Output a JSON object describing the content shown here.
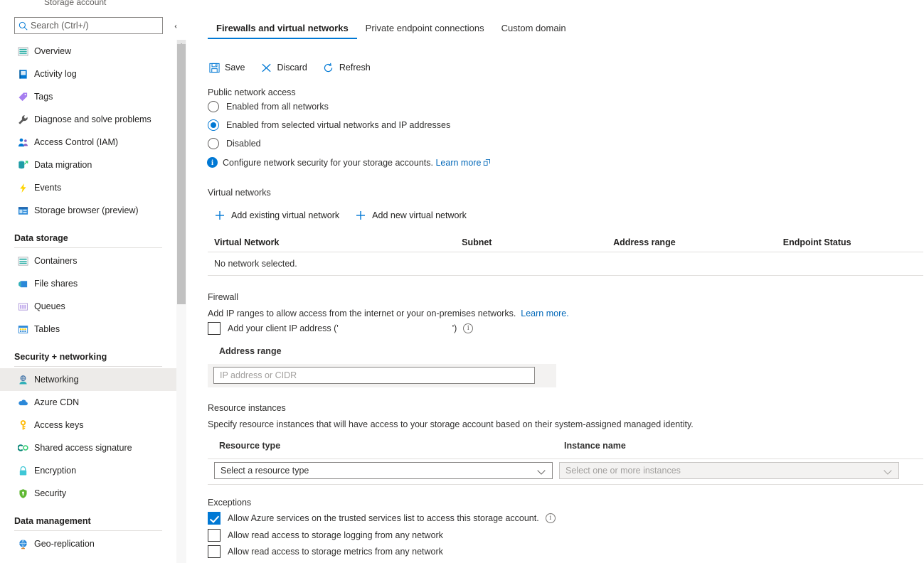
{
  "breadcrumb": {
    "resource_type": "Storage account"
  },
  "sidebar": {
    "search": {
      "placeholder": "Search (Ctrl+/)",
      "value": "",
      "icon": "search-icon"
    },
    "collapse_icon": "chevron-double-left-icon",
    "items": [
      {
        "label": "Overview",
        "icon": "overview-icon",
        "type": "item",
        "selected": false
      },
      {
        "label": "Activity log",
        "icon": "activity-log-icon",
        "type": "item",
        "selected": false
      },
      {
        "label": "Tags",
        "icon": "tags-icon",
        "type": "item",
        "selected": false
      },
      {
        "label": "Diagnose and solve problems",
        "icon": "wrench-icon",
        "type": "item",
        "selected": false
      },
      {
        "label": "Access Control (IAM)",
        "icon": "access-control-icon",
        "type": "item",
        "selected": false
      },
      {
        "label": "Data migration",
        "icon": "data-migration-icon",
        "type": "item",
        "selected": false
      },
      {
        "label": "Events",
        "icon": "events-lightning-icon",
        "type": "item",
        "selected": false
      },
      {
        "label": "Storage browser (preview)",
        "icon": "storage-browser-icon",
        "type": "item",
        "selected": false
      },
      {
        "label": "Data storage",
        "type": "group"
      },
      {
        "label": "Containers",
        "icon": "containers-icon",
        "type": "item",
        "selected": false
      },
      {
        "label": "File shares",
        "icon": "file-shares-icon",
        "type": "item",
        "selected": false
      },
      {
        "label": "Queues",
        "icon": "queues-icon",
        "type": "item",
        "selected": false
      },
      {
        "label": "Tables",
        "icon": "tables-icon",
        "type": "item",
        "selected": false
      },
      {
        "label": "Security + networking",
        "type": "group"
      },
      {
        "label": "Networking",
        "icon": "networking-icon",
        "type": "item",
        "selected": true
      },
      {
        "label": "Azure CDN",
        "icon": "cloud-icon",
        "type": "item",
        "selected": false
      },
      {
        "label": "Access keys",
        "icon": "key-icon",
        "type": "item",
        "selected": false
      },
      {
        "label": "Shared access signature",
        "icon": "shared-access-signature-icon",
        "type": "item",
        "selected": false
      },
      {
        "label": "Encryption",
        "icon": "lock-icon",
        "type": "item",
        "selected": false
      },
      {
        "label": "Security",
        "icon": "shield-icon",
        "type": "item",
        "selected": false
      },
      {
        "label": "Data management",
        "type": "group"
      },
      {
        "label": "Geo-replication",
        "icon": "globe-icon",
        "type": "item",
        "selected": false
      }
    ]
  },
  "main": {
    "tabs": [
      {
        "label": "Firewalls and virtual networks",
        "active": true
      },
      {
        "label": "Private endpoint connections",
        "active": false
      },
      {
        "label": "Custom domain",
        "active": false
      }
    ],
    "toolbar": [
      {
        "label": "Save",
        "icon": "save-disk-icon"
      },
      {
        "label": "Discard",
        "icon": "discard-x-icon"
      },
      {
        "label": "Refresh",
        "icon": "refresh-circular-arrow-icon"
      }
    ],
    "public_network_access": {
      "title": "Public network access",
      "options": [
        {
          "label": "Enabled from all networks",
          "checked": false
        },
        {
          "label": "Enabled from selected virtual networks and IP addresses",
          "checked": true
        },
        {
          "label": "Disabled",
          "checked": false
        }
      ],
      "info": {
        "icon": "info-circle-icon",
        "text": "Configure network security for your storage accounts.",
        "link": "Learn more",
        "link_icon": "external-link-icon"
      }
    },
    "virtual_networks": {
      "title": "Virtual networks",
      "actions": [
        {
          "label": "Add existing virtual network",
          "icon": "plus-icon"
        },
        {
          "label": "Add new virtual network",
          "icon": "plus-icon"
        }
      ],
      "columns": [
        "Virtual Network",
        "Subnet",
        "Address range",
        "Endpoint Status"
      ],
      "empty_message": "No network selected."
    },
    "firewall": {
      "title": "Firewall",
      "description": "Add IP ranges to allow access from the internet or your on-premises networks.",
      "description_link": "Learn more.",
      "client_ip_checkbox": {
        "label_prefix": "Add your client IP address ('",
        "ip_value": "",
        "label_suffix": "')",
        "checked": false,
        "info_icon": "info-circle-outline-icon"
      },
      "address_range_label": "Address range",
      "address_range_placeholder": "IP address or CIDR",
      "address_range_value": ""
    },
    "resource_instances": {
      "title": "Resource instances",
      "description": "Specify resource instances that will have access to your storage account based on their system-assigned managed identity.",
      "columns": [
        "Resource type",
        "Instance name"
      ],
      "resource_type_value": "Select a resource type",
      "instance_name_value": "Select one or more instances"
    },
    "exceptions": {
      "title": "Exceptions",
      "items": [
        {
          "label": "Allow Azure services on the trusted services list to access this storage account.",
          "checked": true,
          "has_info": true
        },
        {
          "label": "Allow read access to storage logging from any network",
          "checked": false,
          "has_info": false
        },
        {
          "label": "Allow read access to storage metrics from any network",
          "checked": false,
          "has_info": false
        }
      ]
    }
  },
  "colors": {
    "accent": "#0078d4",
    "link": "#0067b8",
    "selected_nav_bg": "#edebe9",
    "border": "#e1dfdd",
    "field_shade": "#f3f2f1"
  }
}
